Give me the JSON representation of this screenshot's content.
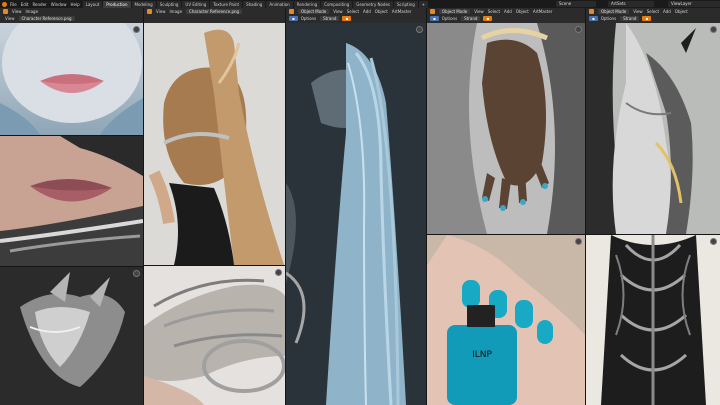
{
  "menu": [
    "File",
    "Edit",
    "Render",
    "Window",
    "Help"
  ],
  "workspaces": [
    "Layout",
    "Production",
    "Modeling",
    "Sculpting",
    "UV Editing",
    "Texture Paint",
    "Shading",
    "Animation",
    "Rendering",
    "Compositing",
    "Geometry Nodes",
    "Scripting"
  ],
  "scene": {
    "name": "Scene",
    "view_layer": "ViewLayer",
    "render": "ArtSets"
  },
  "image_editor_left": {
    "view": "View",
    "image": "Image",
    "view2": "View",
    "image_name": "Character Reference.png"
  },
  "image_editor_mid": {
    "view": "View",
    "image": "Image",
    "image_name": "Character Reference.png"
  },
  "viewports": [
    {
      "mode": "Object Mode",
      "view": "View",
      "select": "Select",
      "add": "Add",
      "object": "Object",
      "artmaster": "ArtMaster",
      "options": "Options",
      "pose": "Strand"
    },
    {
      "mode": "Object Mode",
      "view": "View",
      "select": "Select",
      "add": "Add",
      "object": "Object",
      "artmaster": "ArtMaster",
      "options": "Options",
      "pose": "Strand"
    },
    {
      "mode": "Object Mode",
      "view": "View",
      "select": "Select",
      "add": "Add",
      "object": "Object",
      "artmaster": "ArtMaster",
      "options": "Options",
      "pose": "Strand"
    }
  ],
  "nail_polish_brand": "ILNP",
  "colors": {
    "accent": "#e87d0d",
    "blue": "#4772b3",
    "header": "#2b2b2b",
    "topbar": "#1a1a1a"
  }
}
